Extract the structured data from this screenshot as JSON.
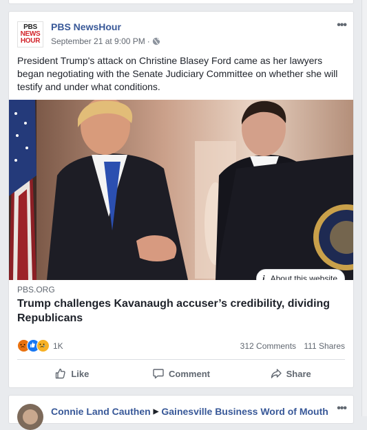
{
  "post": {
    "page_name": "PBS NewsHour",
    "avatar_lines": [
      "PBS",
      "NEWS",
      "HOUR"
    ],
    "timestamp": "September 21 at 9:00 PM",
    "separator": "·",
    "more": "•••",
    "text": "President Trump's attack on Christine Blasey Ford came as her lawyers began negotiating with the Senate Judiciary Committee on whether she will testify and under what conditions.",
    "link": {
      "about_icon": "i",
      "about_label": "About this website",
      "domain": "PBS.ORG",
      "title": "Trump challenges Kavanaugh accuser’s credibility, dividing Republicans"
    },
    "reactions": {
      "icons": [
        "angry-icon",
        "like-icon",
        "sad-icon"
      ],
      "count": "1K",
      "comments": "312 Comments",
      "shares": "111 Shares"
    },
    "actions": {
      "like": "Like",
      "comment": "Comment",
      "share": "Share"
    }
  },
  "next_post": {
    "author": "Connie Land Cauthen",
    "arrow": "▶",
    "group": "Gainesville Business Word of Mouth",
    "more": "•••"
  },
  "colors": {
    "link_blue": "#385898",
    "action_gray": "#606770",
    "background": "#e9ebee"
  }
}
